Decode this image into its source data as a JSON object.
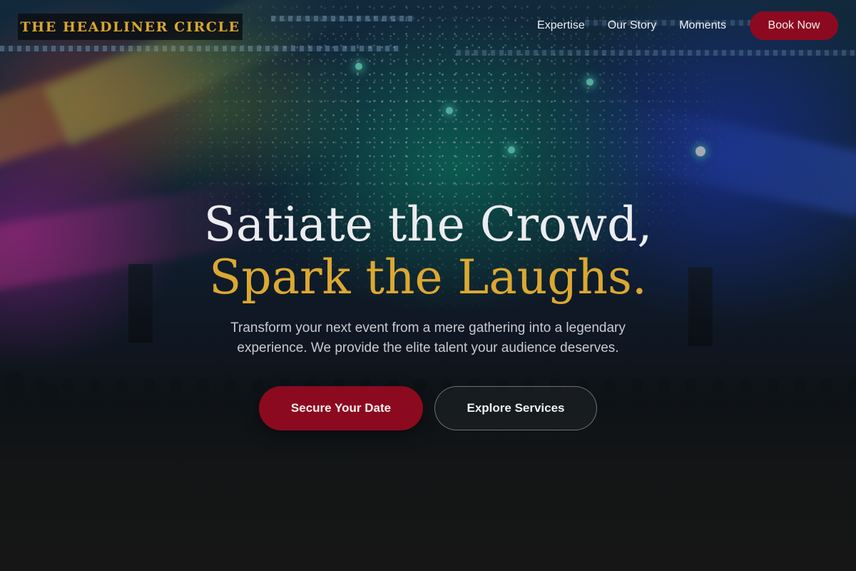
{
  "brand": {
    "name": "THE HEADLINER CIRCLE"
  },
  "nav": {
    "links": [
      {
        "label": "Expertise"
      },
      {
        "label": "Our Story"
      },
      {
        "label": "Moments"
      }
    ],
    "cta_label": "Book Now"
  },
  "hero": {
    "headline_line1": "Satiate the Crowd,",
    "headline_line2": "Spark the Laughs.",
    "subtext": "Transform your next event from a mere gathering into a legendary experience. We provide the elite talent your audience deserves.",
    "primary_cta": "Secure Your Date",
    "secondary_cta": "Explore Services"
  },
  "colors": {
    "accent_gold": "#dba832",
    "primary_red": "#8c0a1f",
    "background_dark": "#161616",
    "text_light": "#ececf0"
  }
}
